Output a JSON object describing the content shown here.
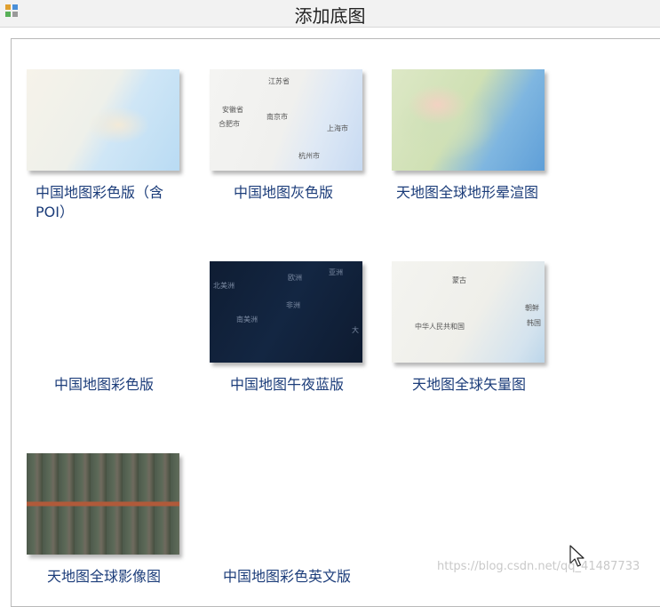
{
  "window": {
    "title": "添加底图"
  },
  "icons": {
    "app": "map-grid-icon",
    "cursor": "pointer-cursor-icon"
  },
  "colors": {
    "label": "#1c3d7a",
    "title": "#222222"
  },
  "basemaps": [
    {
      "label": "中国地图彩色版（含POI）",
      "thumb_text": []
    },
    {
      "label": "中国地图灰色版",
      "thumb_text": [
        "江苏省",
        "安徽省",
        "合肥市",
        "南京市",
        "上海市",
        "杭州市"
      ]
    },
    {
      "label": "天地图全球地形晕渲图",
      "thumb_text": []
    },
    {
      "label": "中国地图彩色版",
      "thumb_text": []
    },
    {
      "label": "中国地图午夜蓝版",
      "thumb_text": [
        "北美洲",
        "欧洲",
        "亚洲",
        "非洲",
        "南美洲",
        "大"
      ]
    },
    {
      "label": "天地图全球矢量图",
      "thumb_text": [
        "蒙古",
        "中华人民共和国",
        "朝鲜",
        "韩国"
      ]
    },
    {
      "label": "天地图全球影像图",
      "thumb_text": []
    },
    {
      "label": "中国地图彩色英文版",
      "thumb_text": []
    }
  ],
  "watermark": "https://blog.csdn.net/qq_41487733"
}
